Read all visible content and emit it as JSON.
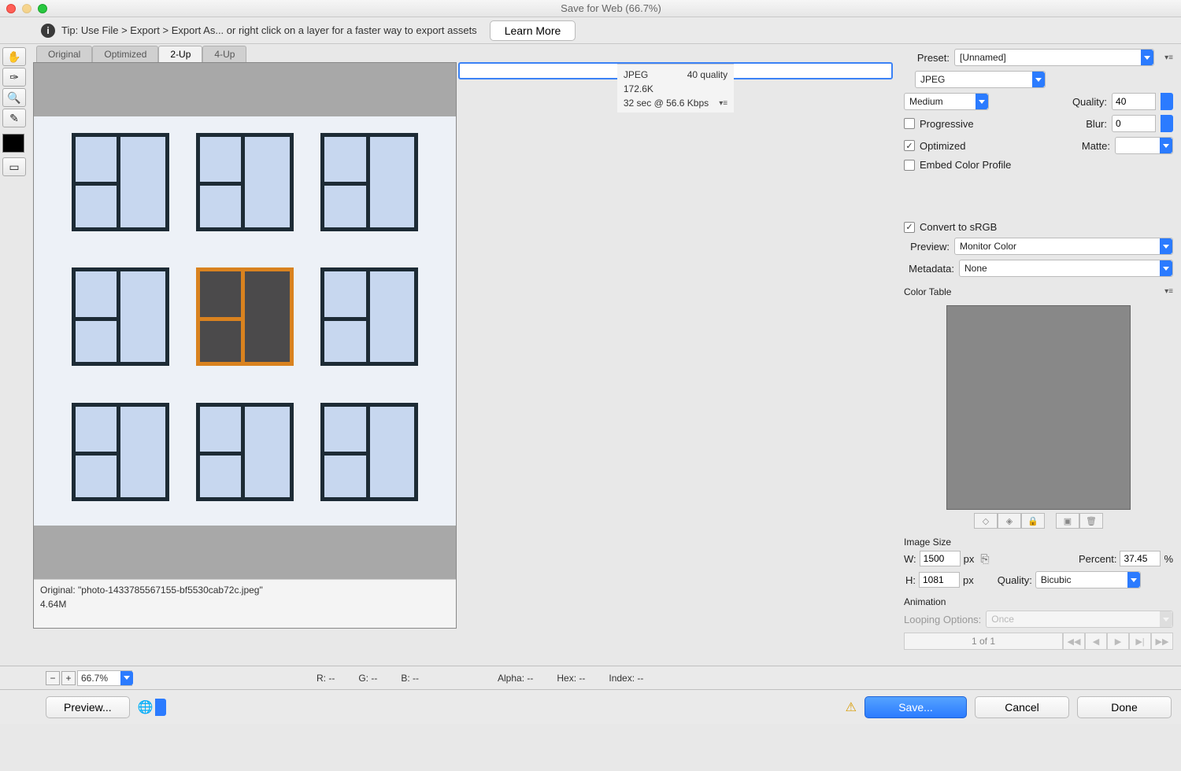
{
  "title": "Save for Web (66.7%)",
  "tip": {
    "prefix": "Tip: ",
    "text": "Use File > Export > Export As...   or right click on a layer for a faster way to export assets",
    "learn_more": "Learn More"
  },
  "tabs": [
    "Original",
    "Optimized",
    "2-Up",
    "4-Up"
  ],
  "active_tab": "2-Up",
  "left_pane": {
    "title": "Original: \"photo-1433785567155-bf5530cab72c.jpeg\"",
    "size": "4.64M"
  },
  "right_pane": {
    "format": "JPEG",
    "quality_line": "40 quality",
    "size": "172.6K",
    "time": "32 sec @ 56.6 Kbps"
  },
  "preset": {
    "label": "Preset:",
    "value": "[Unnamed]",
    "format": "JPEG",
    "quality_preset": "Medium",
    "quality_label": "Quality:",
    "quality_value": "40",
    "progressive_label": "Progressive",
    "progressive": false,
    "blur_label": "Blur:",
    "blur_value": "0",
    "optimized_label": "Optimized",
    "optimized": true,
    "matte_label": "Matte:",
    "matte_value": "",
    "embed_label": "Embed Color Profile",
    "embed": false
  },
  "srgb": {
    "label": "Convert to sRGB",
    "checked": true
  },
  "preview": {
    "label": "Preview:",
    "value": "Monitor Color"
  },
  "metadata": {
    "label": "Metadata:",
    "value": "None"
  },
  "color_table": {
    "label": "Color Table"
  },
  "image_size": {
    "label": "Image Size",
    "w_label": "W:",
    "w": "1500",
    "h_label": "H:",
    "h": "1081",
    "px": "px",
    "percent_label": "Percent:",
    "percent": "37.45",
    "pct_sign": "%",
    "quality_label": "Quality:",
    "quality_sel": "Bicubic"
  },
  "animation": {
    "label": "Animation",
    "loop_label": "Looping Options:",
    "loop_value": "Once",
    "page": "1 of 1"
  },
  "status": {
    "zoom": "66.7%",
    "r": "R:  --",
    "g": "G:  --",
    "b": "B:  --",
    "alpha": "Alpha:  --",
    "hex": "Hex:  --",
    "index": "Index:  --"
  },
  "footer": {
    "preview": "Preview...",
    "save": "Save...",
    "cancel": "Cancel",
    "done": "Done"
  }
}
